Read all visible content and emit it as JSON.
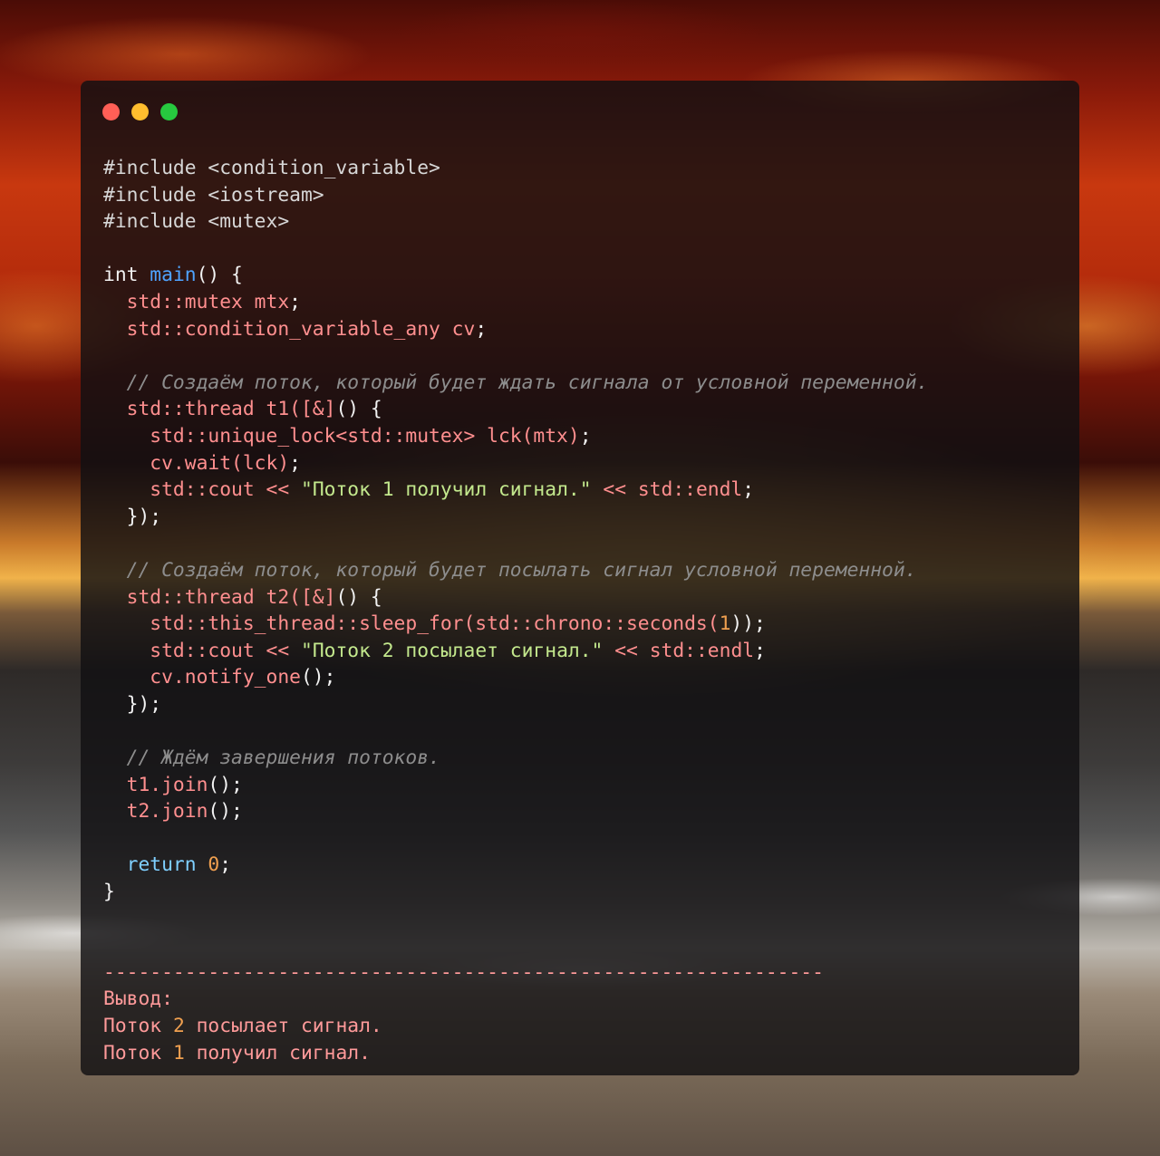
{
  "window_controls": [
    "close",
    "minimize",
    "maximize"
  ],
  "code": {
    "include1": "#include <condition_variable>",
    "include2": "#include <iostream>",
    "include3": "#include <mutex>",
    "int_kw": "int",
    "main_fn": "main",
    "main_rest": "() {",
    "mtx_decl": "  std::mutex mtx",
    "cv_decl": "  std::condition_variable_any cv",
    "comment1": "  // Создаём поток, который будет ждать сигнала от условной переменной.",
    "t1_decl": "  std::thread t1(",
    "t1_capture": "[&]",
    "t1_rest": "() {",
    "lock_decl": "    std::unique_lock<std::mutex> lck(mtx)",
    "wait_call": "    cv.wait(lck)",
    "cout1_pre": "    std::cout ",
    "cout1_op": "<<",
    "cout1_str": "\"Поток 1 получил сигнал.\"",
    "cout1_op2": "<<",
    "cout1_endl": "std::endl",
    "close1": "  });",
    "comment2": "  // Создаём поток, который будет посылать сигнал условной переменной.",
    "t2_decl": "  std::thread t2(",
    "t2_capture": "[&]",
    "t2_rest": "() {",
    "sleep_pre": "    std::this_thread::sleep_for(std::chrono::seconds(",
    "sleep_num": "1",
    "sleep_post": "));",
    "cout2_pre": "    std::cout ",
    "cout2_op": "<<",
    "cout2_str": "\"Поток 2 посылает сигнал.\"",
    "cout2_op2": "<<",
    "cout2_endl": "std::endl",
    "notify_call": "    cv.notify_one",
    "close2": "  });",
    "comment3": "  // Ждём завершения потоков.",
    "join1": "  t1.join",
    "join2": "  t2.join",
    "return_kw": "  return",
    "return_val": "0",
    "close_main": "}"
  },
  "output": {
    "separator": "--------------------------------------------------------------",
    "label": "Вывод:",
    "line1_a": "Поток ",
    "line1_num": "2",
    "line1_b": " посылает сигнал.",
    "line2_a": "Поток ",
    "line2_num": "1",
    "line2_b": " получил сигнал."
  },
  "colors": {
    "keyword": "#f2f2f2",
    "function": "#4fa3ff",
    "std_identifiers": "#ff8f8f",
    "comment": "#8d8d8d",
    "string": "#c3e88d",
    "number": "#f0a050",
    "return_keyword": "#7fd0ff"
  }
}
